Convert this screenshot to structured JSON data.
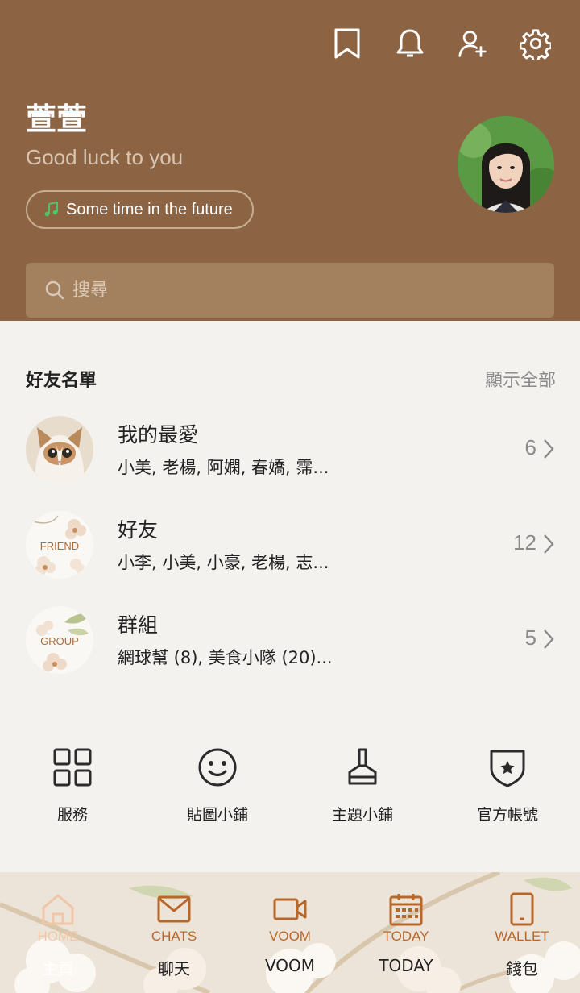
{
  "header": {
    "icons": [
      "bookmark-icon",
      "bell-icon",
      "add-friend-icon",
      "gear-icon"
    ],
    "profile_name": "萱萱",
    "status_message": "Good luck to you",
    "music_label": "Some time in the future",
    "search_placeholder": "搜尋"
  },
  "friends": {
    "title": "好友名單",
    "show_all": "顯示全部",
    "groups": [
      {
        "name": "我的最愛",
        "members": "小美, 老楊, 阿嫻, 春嬌, 霈...",
        "count": "6"
      },
      {
        "name": "好友",
        "members": "小李, 小美, 小豪, 老楊, 志...",
        "count": "12",
        "badge": "FRIEND"
      },
      {
        "name": "群組",
        "members": "網球幫 (8), 美食小隊 (20)...",
        "count": "5",
        "badge": "GROUP"
      }
    ]
  },
  "shortcuts": [
    {
      "label": "服務",
      "icon": "grid-icon"
    },
    {
      "label": "貼圖小鋪",
      "icon": "smiley-icon"
    },
    {
      "label": "主題小鋪",
      "icon": "brush-icon"
    },
    {
      "label": "官方帳號",
      "icon": "shield-star-icon"
    }
  ],
  "nav": [
    {
      "en": "HOME",
      "zh": "主頁",
      "icon": "home-icon"
    },
    {
      "en": "CHATS",
      "zh": "聊天",
      "icon": "mail-icon"
    },
    {
      "en": "VOOM",
      "zh": "VOOM",
      "icon": "video-icon"
    },
    {
      "en": "TODAY",
      "zh": "TODAY",
      "icon": "calendar-icon"
    },
    {
      "en": "WALLET",
      "zh": "錢包",
      "icon": "phone-icon"
    }
  ],
  "colors": {
    "header_bg": "#8c6443",
    "accent": "#b8672b",
    "page_bg": "#f4f2ef"
  }
}
